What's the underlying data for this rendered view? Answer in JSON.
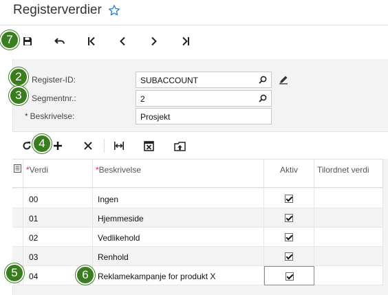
{
  "page": {
    "title": "Registerverdier"
  },
  "callouts": {
    "c7": "7",
    "c2": "2",
    "c3": "3",
    "c4": "4",
    "c5": "5",
    "c6": "6"
  },
  "form": {
    "register_id": {
      "label": "Register-ID:",
      "value": "SUBACCOUNT"
    },
    "segment": {
      "label": "Segmentnr.:",
      "value": "2"
    },
    "description": {
      "required": "*",
      "label": "Beskrivelse:",
      "value": "Prosjekt"
    }
  },
  "grid": {
    "columns": {
      "value": {
        "required": "*",
        "label": "Verdi"
      },
      "description": {
        "required": "*",
        "label": "Beskrivelse"
      },
      "active": "Aktiv",
      "mapped": "Tilordnet verdi"
    },
    "rows": [
      {
        "value": "00",
        "description": "Ingen",
        "active": true
      },
      {
        "value": "01",
        "description": "Hjemmeside",
        "active": true
      },
      {
        "value": "02",
        "description": "Vedlikehold",
        "active": true
      },
      {
        "value": "03",
        "description": "Renhold",
        "active": true
      },
      {
        "value": "04",
        "description": "Reklamekampanje for produkt X",
        "active": true
      }
    ]
  },
  "icons": {
    "title_star": "star-icon",
    "accent": "#3a7d1e"
  }
}
